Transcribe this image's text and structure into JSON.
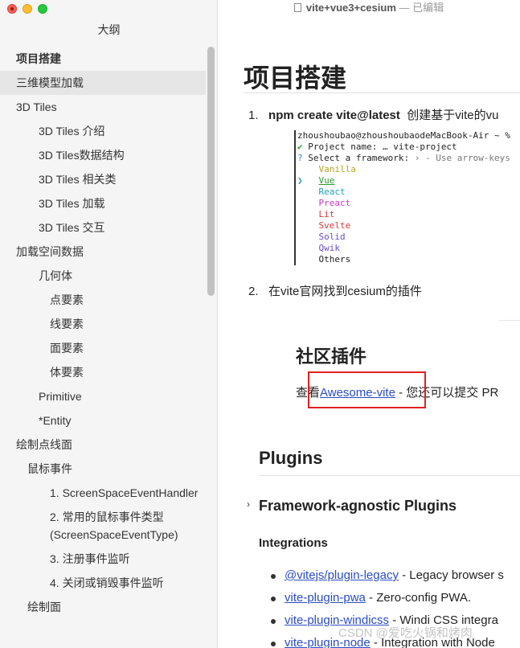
{
  "window": {
    "document_title": "vite+vue3+cesium",
    "separator": " — ",
    "status": "已编辑"
  },
  "sidebar": {
    "title": "大纲",
    "items": [
      {
        "label": "项目搭建",
        "level": 1,
        "bold": true
      },
      {
        "label": "三维模型加载",
        "level": 1,
        "active": true
      },
      {
        "label": "3D Tiles",
        "level": 1
      },
      {
        "label": "3D Tiles 介绍",
        "level": 3
      },
      {
        "label": "3D Tiles数据结构",
        "level": 3
      },
      {
        "label": "3D Tiles 相关类",
        "level": 3
      },
      {
        "label": "3D Tiles 加载",
        "level": 3
      },
      {
        "label": "3D Tiles 交互",
        "level": 3
      },
      {
        "label": "加载空间数据",
        "level": 1
      },
      {
        "label": "几何体",
        "level": 3
      },
      {
        "label": "点要素",
        "level": 4
      },
      {
        "label": "线要素",
        "level": 4
      },
      {
        "label": "面要素",
        "level": 4
      },
      {
        "label": "体要素",
        "level": 4
      },
      {
        "label": "Primitive",
        "level": 3
      },
      {
        "label": "*Entity",
        "level": 3
      },
      {
        "label": "绘制点线面",
        "level": 1
      },
      {
        "label": "鼠标事件",
        "level": 2
      },
      {
        "label": "1. ScreenSpaceEventHandler",
        "level": 4
      },
      {
        "label": "2. 常用的鼠标事件类型(ScreenSpaceEventType)",
        "level": 4
      },
      {
        "label": "3. 注册事件监听",
        "level": 4
      },
      {
        "label": "4. 关闭或销毁事件监听",
        "level": 4
      },
      {
        "label": "绘制面",
        "level": 2
      }
    ]
  },
  "main": {
    "h1": "项目搭建",
    "steps": [
      {
        "num": "1.",
        "cmd": "npm create vite@latest",
        "text": "创建基于vite的vu"
      },
      {
        "num": "2.",
        "cmd": "",
        "text": "在vite官网找到cesium的插件"
      }
    ],
    "terminal": {
      "prompt": "zhoushoubao@zhoushoubaodeMacBook-Air ~ %",
      "check": "✔",
      "project_line": "Project name: … vite-project",
      "question": "?",
      "select_line": "Select a framework:",
      "hint": "› - Use arrow-keys",
      "pointer": "❯",
      "options": [
        "Vanilla",
        "Vue",
        "React",
        "Preact",
        "Lit",
        "Svelte",
        "Solid",
        "Qwik",
        "Others"
      ]
    },
    "community_heading": "社区插件",
    "community_prefix": "查看",
    "community_link": "Awesome-vite",
    "community_suffix": " - 您还可以提交 PR",
    "plugins_heading": "Plugins",
    "framework_heading": "Framework-agnostic Plugins",
    "integrations_heading": "Integrations",
    "plugins": [
      {
        "name": "@vitejs/plugin-legacy",
        "desc": " - Legacy browser s"
      },
      {
        "name": "vite-plugin-pwa",
        "desc": " - Zero-config PWA."
      },
      {
        "name": "vite-plugin-windicss",
        "desc": " - Windi CSS integra"
      },
      {
        "name": "vite-plugin-node",
        "desc": " - Integration with Node"
      }
    ],
    "watermark": "CSDN @爱吃火锅和烤肉"
  }
}
